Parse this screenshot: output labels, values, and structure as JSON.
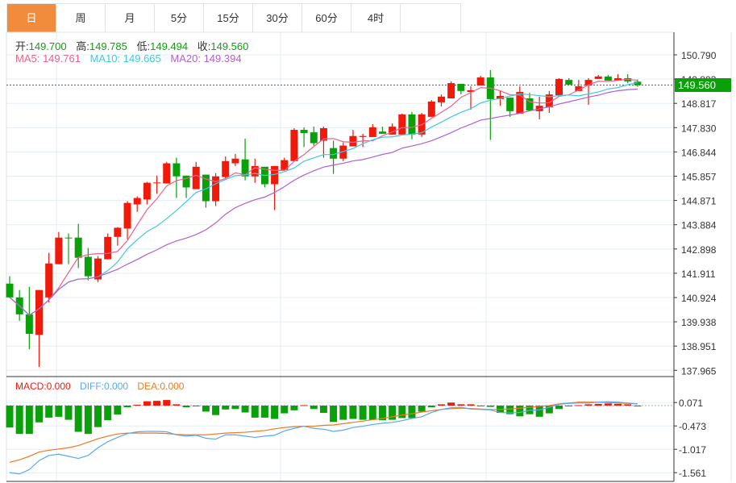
{
  "tabs": [
    "日",
    "周",
    "月",
    "5分",
    "15分",
    "30分",
    "60分",
    "4时",
    ""
  ],
  "active_tab": 0,
  "ohlc": {
    "open_label": "开:",
    "open": "149.700",
    "high_label": "高:",
    "high": "149.785",
    "low_label": "低:",
    "low": "149.494",
    "close_label": "收:",
    "close": "149.560"
  },
  "ma": {
    "ma5": "MA5: 149.761",
    "ma10": "MA10: 149.665",
    "ma20": "MA20: 149.394"
  },
  "macd_legend": {
    "macd": "MACD:0.000",
    "diff": "DIFF:0.000",
    "dea": "DEA:0.000"
  },
  "current_price": "149.560",
  "colors": {
    "up": "#f01a0a",
    "down": "#0aa00a",
    "ma5": "#f0608a",
    "ma10": "#40c8e0",
    "ma20": "#b060d0",
    "diff": "#5aa8f0",
    "dea": "#f07820",
    "accent": "#f08c3c"
  },
  "price_axis": [
    "150.790",
    "149.803",
    "148.817",
    "147.830",
    "146.844",
    "145.857",
    "144.871",
    "143.884",
    "142.898",
    "141.911",
    "140.924",
    "139.938",
    "138.951",
    "137.965"
  ],
  "macd_axis": [
    "0.071",
    "-0.473",
    "-1.017",
    "-1.561"
  ],
  "chart_data": {
    "type": "candlestick",
    "ylim": [
      137.965,
      150.79
    ],
    "candles": [
      [
        141.49,
        141.79,
        140.93,
        140.93
      ],
      [
        140.93,
        141.23,
        139.98,
        140.24
      ],
      [
        140.24,
        141.36,
        138.82,
        139.45
      ],
      [
        139.41,
        141.23,
        138.1,
        141.23
      ],
      [
        140.93,
        142.74,
        140.73,
        142.31
      ],
      [
        142.28,
        143.59,
        142.28,
        143.36
      ],
      [
        143.36,
        143.53,
        142.28,
        143.35
      ],
      [
        143.36,
        143.92,
        142.12,
        142.54
      ],
      [
        142.58,
        142.94,
        141.62,
        141.79
      ],
      [
        141.66,
        142.61,
        141.55,
        142.51
      ],
      [
        142.48,
        143.53,
        142.48,
        143.39
      ],
      [
        143.39,
        143.79,
        143.03,
        143.76
      ],
      [
        143.73,
        144.84,
        143.29,
        144.77
      ],
      [
        144.71,
        145.04,
        144.41,
        144.97
      ],
      [
        144.91,
        145.62,
        144.71,
        145.59
      ],
      [
        145.59,
        145.88,
        145.14,
        145.6
      ],
      [
        145.56,
        146.44,
        145.56,
        146.38
      ],
      [
        146.38,
        146.61,
        144.97,
        145.85
      ],
      [
        145.88,
        145.88,
        144.97,
        145.4
      ],
      [
        145.33,
        146.44,
        145.33,
        146.24
      ],
      [
        145.92,
        145.92,
        144.58,
        144.84
      ],
      [
        144.84,
        145.98,
        144.64,
        145.85
      ],
      [
        145.82,
        146.66,
        145.76,
        146.47
      ],
      [
        146.38,
        146.76,
        146.27,
        146.57
      ],
      [
        146.54,
        147.38,
        145.69,
        145.85
      ],
      [
        145.85,
        146.57,
        145.59,
        146.27
      ],
      [
        146.24,
        146.24,
        145.4,
        145.53
      ],
      [
        145.53,
        146.27,
        144.48,
        146.27
      ],
      [
        146.11,
        146.61,
        146.11,
        146.51
      ],
      [
        146.47,
        147.81,
        146.47,
        147.74
      ],
      [
        147.74,
        147.84,
        147.04,
        147.61
      ],
      [
        147.64,
        147.87,
        147.1,
        147.2
      ],
      [
        147.3,
        147.87,
        146.61,
        147.81
      ],
      [
        147.0,
        147.3,
        145.95,
        146.57
      ],
      [
        146.57,
        147.23,
        146.47,
        147.1
      ],
      [
        147.07,
        147.74,
        147.07,
        147.49
      ],
      [
        147.45,
        147.58,
        147.04,
        147.49
      ],
      [
        147.45,
        147.97,
        147.45,
        147.84
      ],
      [
        147.67,
        147.87,
        147.58,
        147.58
      ],
      [
        147.55,
        148.0,
        147.55,
        147.87
      ],
      [
        147.55,
        148.4,
        147.55,
        148.37
      ],
      [
        148.37,
        148.47,
        147.36,
        147.55
      ],
      [
        147.55,
        148.43,
        147.45,
        148.37
      ],
      [
        148.27,
        148.95,
        148.27,
        148.89
      ],
      [
        148.86,
        149.18,
        148.69,
        149.09
      ],
      [
        149.02,
        149.71,
        149.02,
        149.64
      ],
      [
        149.61,
        149.61,
        149.18,
        149.32
      ],
      [
        149.28,
        149.51,
        148.56,
        149.35
      ],
      [
        149.54,
        149.94,
        149.54,
        149.87
      ],
      [
        149.87,
        150.17,
        147.33,
        148.99
      ],
      [
        148.99,
        149.32,
        148.72,
        149.12
      ],
      [
        149.05,
        149.05,
        148.27,
        148.5
      ],
      [
        148.4,
        149.51,
        148.4,
        149.28
      ],
      [
        149.02,
        149.25,
        148.53,
        148.53
      ],
      [
        148.5,
        149.09,
        148.17,
        148.72
      ],
      [
        148.66,
        149.32,
        148.43,
        149.18
      ],
      [
        149.15,
        149.84,
        149.15,
        149.81
      ],
      [
        149.77,
        149.84,
        149.58,
        149.58
      ],
      [
        149.32,
        149.77,
        149.32,
        149.51
      ],
      [
        149.54,
        149.84,
        148.76,
        149.77
      ],
      [
        149.81,
        149.97,
        149.81,
        149.91
      ],
      [
        149.91,
        149.97,
        149.74,
        149.74
      ],
      [
        149.74,
        150.0,
        149.74,
        149.84
      ],
      [
        149.84,
        150.0,
        149.64,
        149.71
      ],
      [
        149.7,
        149.785,
        149.494,
        149.56
      ]
    ],
    "macd_ylim": [
      -1.561,
      0.071
    ],
    "macd_hist": [
      -0.51,
      -0.66,
      -0.66,
      -0.39,
      -0.28,
      -0.26,
      -0.33,
      -0.61,
      -0.66,
      -0.5,
      -0.34,
      -0.21,
      -0.04,
      0.02,
      0.1,
      0.11,
      0.13,
      0.03,
      -0.04,
      -0.01,
      -0.14,
      -0.22,
      -0.09,
      -0.08,
      -0.16,
      -0.28,
      -0.28,
      -0.31,
      -0.18,
      -0.11,
      0.01,
      -0.08,
      -0.17,
      -0.38,
      -0.33,
      -0.31,
      -0.33,
      -0.33,
      -0.34,
      -0.33,
      -0.29,
      -0.29,
      -0.14,
      -0.04,
      0.03,
      0.07,
      0.03,
      0.03,
      -0.01,
      -0.03,
      -0.17,
      -0.2,
      -0.25,
      -0.2,
      -0.26,
      -0.18,
      -0.08,
      -0.01,
      0.01,
      0.03,
      0.04,
      0.05,
      0.04,
      0.03,
      0.0
    ],
    "diff": [
      -1.56,
      -1.59,
      -1.49,
      -1.28,
      -1.16,
      -1.13,
      -1.18,
      -1.23,
      -1.16,
      -0.98,
      -0.84,
      -0.74,
      -0.65,
      -0.61,
      -0.6,
      -0.6,
      -0.61,
      -0.68,
      -0.71,
      -0.69,
      -0.76,
      -0.78,
      -0.68,
      -0.68,
      -0.71,
      -0.74,
      -0.71,
      -0.69,
      -0.59,
      -0.53,
      -0.48,
      -0.53,
      -0.55,
      -0.6,
      -0.57,
      -0.51,
      -0.48,
      -0.44,
      -0.41,
      -0.39,
      -0.35,
      -0.3,
      -0.26,
      -0.16,
      -0.09,
      -0.05,
      -0.04,
      -0.08,
      -0.09,
      -0.1,
      -0.16,
      -0.17,
      -0.16,
      -0.11,
      -0.1,
      -0.04,
      0.03,
      0.05,
      0.06,
      0.06,
      0.08,
      0.09,
      0.08,
      0.06,
      0.04
    ],
    "dea": [
      -1.32,
      -1.26,
      -1.18,
      -1.08,
      -1.04,
      -1.01,
      -0.98,
      -0.93,
      -0.85,
      -0.77,
      -0.71,
      -0.66,
      -0.64,
      -0.64,
      -0.64,
      -0.64,
      -0.65,
      -0.67,
      -0.68,
      -0.68,
      -0.68,
      -0.66,
      -0.64,
      -0.63,
      -0.62,
      -0.6,
      -0.58,
      -0.54,
      -0.51,
      -0.49,
      -0.48,
      -0.48,
      -0.46,
      -0.45,
      -0.42,
      -0.39,
      -0.36,
      -0.33,
      -0.3,
      -0.26,
      -0.22,
      -0.19,
      -0.15,
      -0.12,
      -0.09,
      -0.07,
      -0.06,
      -0.07,
      -0.08,
      -0.09,
      -0.09,
      -0.08,
      -0.06,
      -0.04,
      -0.02,
      0.0,
      0.04,
      0.06,
      0.08,
      0.08,
      0.08,
      0.07,
      0.06,
      0.05,
      0.04
    ]
  }
}
